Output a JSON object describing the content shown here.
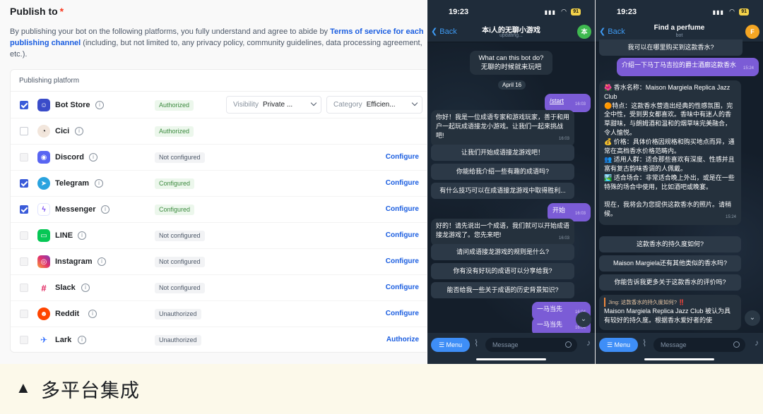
{
  "publish": {
    "title": "Publish to",
    "required_mark": "*",
    "desc_pre": "By publishing your bot on the following platforms, you fully understand and agree to abide by ",
    "desc_link": "Terms of service for each publishing channel",
    "desc_post": " (including, but not limited to, any privacy policy, community guidelines, data processing agreement, etc.).",
    "table_header": "Publishing platform",
    "visibility_label": "Visibility",
    "visibility_value": "Private ...",
    "category_label": "Category",
    "category_value": "Efficien...",
    "platforms": [
      {
        "name": "Bot Store",
        "status": "Authorized",
        "checked": true,
        "action": ""
      },
      {
        "name": "Cici",
        "status": "Authorized",
        "checked": false,
        "action": ""
      },
      {
        "name": "Discord",
        "status": "Not configured",
        "checked": false,
        "action": "Configure"
      },
      {
        "name": "Telegram",
        "status": "Configured",
        "checked": true,
        "action": "Configure"
      },
      {
        "name": "Messenger",
        "status": "Configured",
        "checked": true,
        "action": "Configure"
      },
      {
        "name": "LINE",
        "status": "Not configured",
        "checked": false,
        "action": "Configure"
      },
      {
        "name": "Instagram",
        "status": "Not configured",
        "checked": false,
        "action": "Configure"
      },
      {
        "name": "Slack",
        "status": "Not configured",
        "checked": false,
        "action": "Configure"
      },
      {
        "name": "Reddit",
        "status": "Unauthorized",
        "checked": false,
        "action": "Configure"
      },
      {
        "name": "Lark",
        "status": "Unauthorized",
        "checked": false,
        "action": "Authorize"
      }
    ]
  },
  "caption": {
    "marker": "▲",
    "text": "多平台集成"
  },
  "phone1": {
    "time": "19:23",
    "battery": "91",
    "back": "Back",
    "title": "本i人的无聊小游戏",
    "subtitle": "updating...",
    "avatar": "本",
    "header_msg": "What can this bot do?\n无聊的时候就来玩吧",
    "date": "April 16",
    "m_start": "/start",
    "m_start_ts": "16:03",
    "m_greet": "你好！我是一位成语专家和游戏玩家，善于和用户一起玩成语接龙小游戏。让我们一起来挑战吧!",
    "m_greet_ts": "16:03",
    "b1": "让我们开始成语接龙游戏吧！",
    "b2": "你能给我介绍一些有趣的成语吗?",
    "b3": "有什么技巧可以在成语接龙游戏中取得胜利...",
    "m_begin": "开始",
    "m_begin_ts": "16:03",
    "m_reply": "好的！请先说出一个成语，我们就可以开始成语接龙游戏了。您先来吧!",
    "m_reply_ts": "16:03",
    "b4": "请问成语接龙游戏的规则是什么?",
    "b5": "你有没有好玩的成语可以分享给我?",
    "b6": "能否给我一些关于成语的历史背景知识?",
    "m_idiom1": "一马当先",
    "m_idiom1_ts": "16:04",
    "m_idiom2": "一马当先",
    "m_idiom2_ts": "16:04",
    "menu": "Menu",
    "message_placeholder": "Message"
  },
  "phone2": {
    "time": "19:23",
    "battery": "91",
    "back": "Back",
    "title": "Find a perfume",
    "subtitle": "bot",
    "avatar": "F",
    "top_msg": "我可以在哪里购买到这款香水?",
    "m_user": "介绍一下马丁马吉拉的爵士酒廊这款香水",
    "m_user_ts": "15:24",
    "m_detail": "🌺 香水名称：Maison Margiela Replica Jazz Club\n🟠特点：这款香水营造出经典的性感氛围，完全中性，受到男女都喜欢。香味中有迷人的香草甜味，与朗姆酒和温和的烟草味完美融合，令人愉悦。\n💰 价格：具体价格因规格和购买地点而异，通常在高档香水价格范畴内。\n👥 适用人群：适合那些喜欢有深度、性感并且富有复古韵味香调的人佩戴。\n🏞️ 适合场合：非常适合晚上外出，或是在一些特殊的场合中使用，比如酒吧或晚宴。\n\n现在，我将会为您提供这款香水的照片。请稍候。",
    "m_detail_ts": "15:24",
    "b1": "这款香水的持久度如何?",
    "b2": "Maison Margiela还有其他类似的香水吗?",
    "b3": "你能告诉我更多关于这款香水的评价吗?",
    "reply_quote": "Jing: 这款香水的持久度如何? ‼️",
    "reply_text": "Maison Margiela Replica Jazz Club 被认为具有较好的持久度。根据香水爱好者的使",
    "menu": "Menu",
    "message_placeholder": "Message"
  },
  "colors": {
    "accent": "#1a5de0",
    "checkbox": "#3a5bd9",
    "telegram_bg": "#1b2733",
    "outgoing": "#7b5cd6",
    "menu_button": "#3e8ef7"
  }
}
